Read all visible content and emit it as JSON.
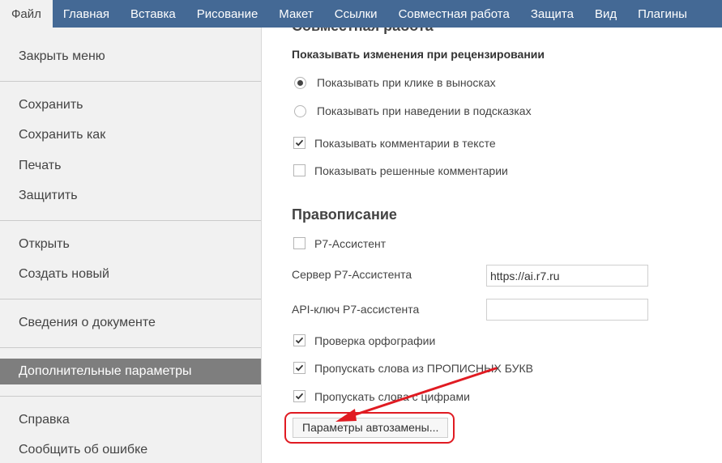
{
  "tabs": [
    "Файл",
    "Главная",
    "Вставка",
    "Рисование",
    "Макет",
    "Ссылки",
    "Совместная работа",
    "Защита",
    "Вид",
    "Плагины"
  ],
  "sidebar": {
    "close": "Закрыть меню",
    "save": "Сохранить",
    "save_as": "Сохранить как",
    "print": "Печать",
    "protect": "Защитить",
    "open": "Открыть",
    "create_new": "Создать новый",
    "doc_info": "Сведения о документе",
    "advanced": "Дополнительные параметры",
    "help": "Справка",
    "report": "Сообщить об ошибке"
  },
  "collab": {
    "heading": "Совместная работа",
    "review_title": "Показывать изменения при рецензировании",
    "radio_click": "Показывать при клике в выносках",
    "radio_hover": "Показывать при наведении в подсказках",
    "radio_selected": "click",
    "show_comments": "Показывать комментарии в тексте",
    "show_comments_checked": true,
    "show_resolved": "Показывать решенные комментарии",
    "show_resolved_checked": false
  },
  "spelling": {
    "title": "Правописание",
    "assistant": "Р7-Ассистент",
    "assistant_checked": false,
    "server_label": "Сервер Р7-Ассистента",
    "server_value": "https://ai.r7.ru",
    "api_label": "API-ключ Р7-ассистента",
    "api_value": "",
    "spellcheck": "Проверка орфографии",
    "spellcheck_checked": true,
    "skip_upper": "Пропускать слова из ПРОПИСНЫХ БУКВ",
    "skip_upper_checked": true,
    "skip_digits": "Пропускать слова с цифрами",
    "skip_digits_checked": true,
    "autocorrect_button": "Параметры автозамены..."
  },
  "colors": {
    "topbar": "#446995",
    "sidebar_bg": "#f1f1f1",
    "selected_item": "#7e7e7e",
    "annotation": "#e01b22"
  }
}
